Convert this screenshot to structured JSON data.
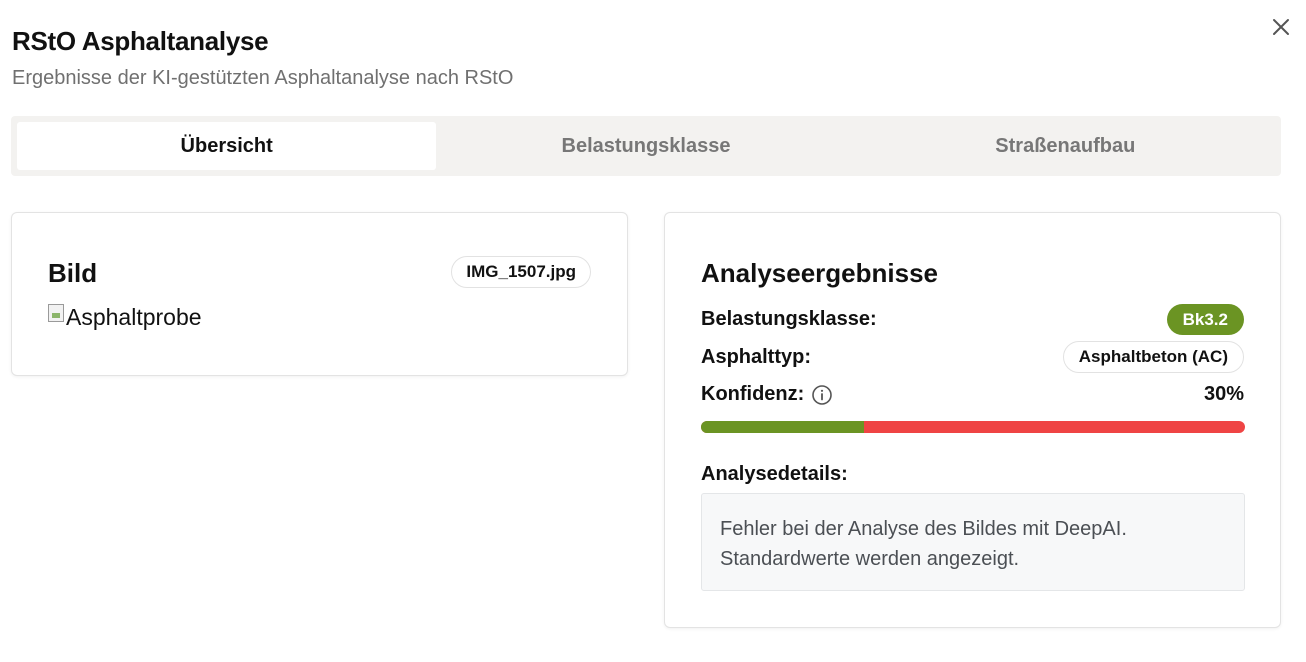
{
  "dialog": {
    "title": "RStO Asphaltanalyse",
    "subtitle": "Ergebnisse der KI-gestützten Asphaltanalyse nach RStO",
    "close_icon": "close-icon"
  },
  "tabs": [
    {
      "label": "Übersicht",
      "active": true
    },
    {
      "label": "Belastungsklasse",
      "active": false
    },
    {
      "label": "Straßenaufbau",
      "active": false
    }
  ],
  "image_card": {
    "heading": "Bild",
    "filename": "IMG_1507.jpg",
    "image_alt": "Asphaltprobe"
  },
  "results_card": {
    "heading": "Analyseergebnisse",
    "belastungsklasse_label": "Belastungsklasse:",
    "belastungsklasse_value": "Bk3.2",
    "asphalttyp_label": "Asphalttyp:",
    "asphalttyp_value": "Asphaltbeton (AC)",
    "konfidenz_label": "Konfidenz:",
    "konfidenz_value": "30%",
    "konfidenz_fraction": 0.3,
    "details_label": "Analysedetails:",
    "details_text": "Fehler bei der Analyse des Bildes mit DeepAI. Standardwerte werden angezeigt."
  },
  "colors": {
    "accent_green": "#6b9423",
    "progress_remaining": "#ef4444"
  }
}
